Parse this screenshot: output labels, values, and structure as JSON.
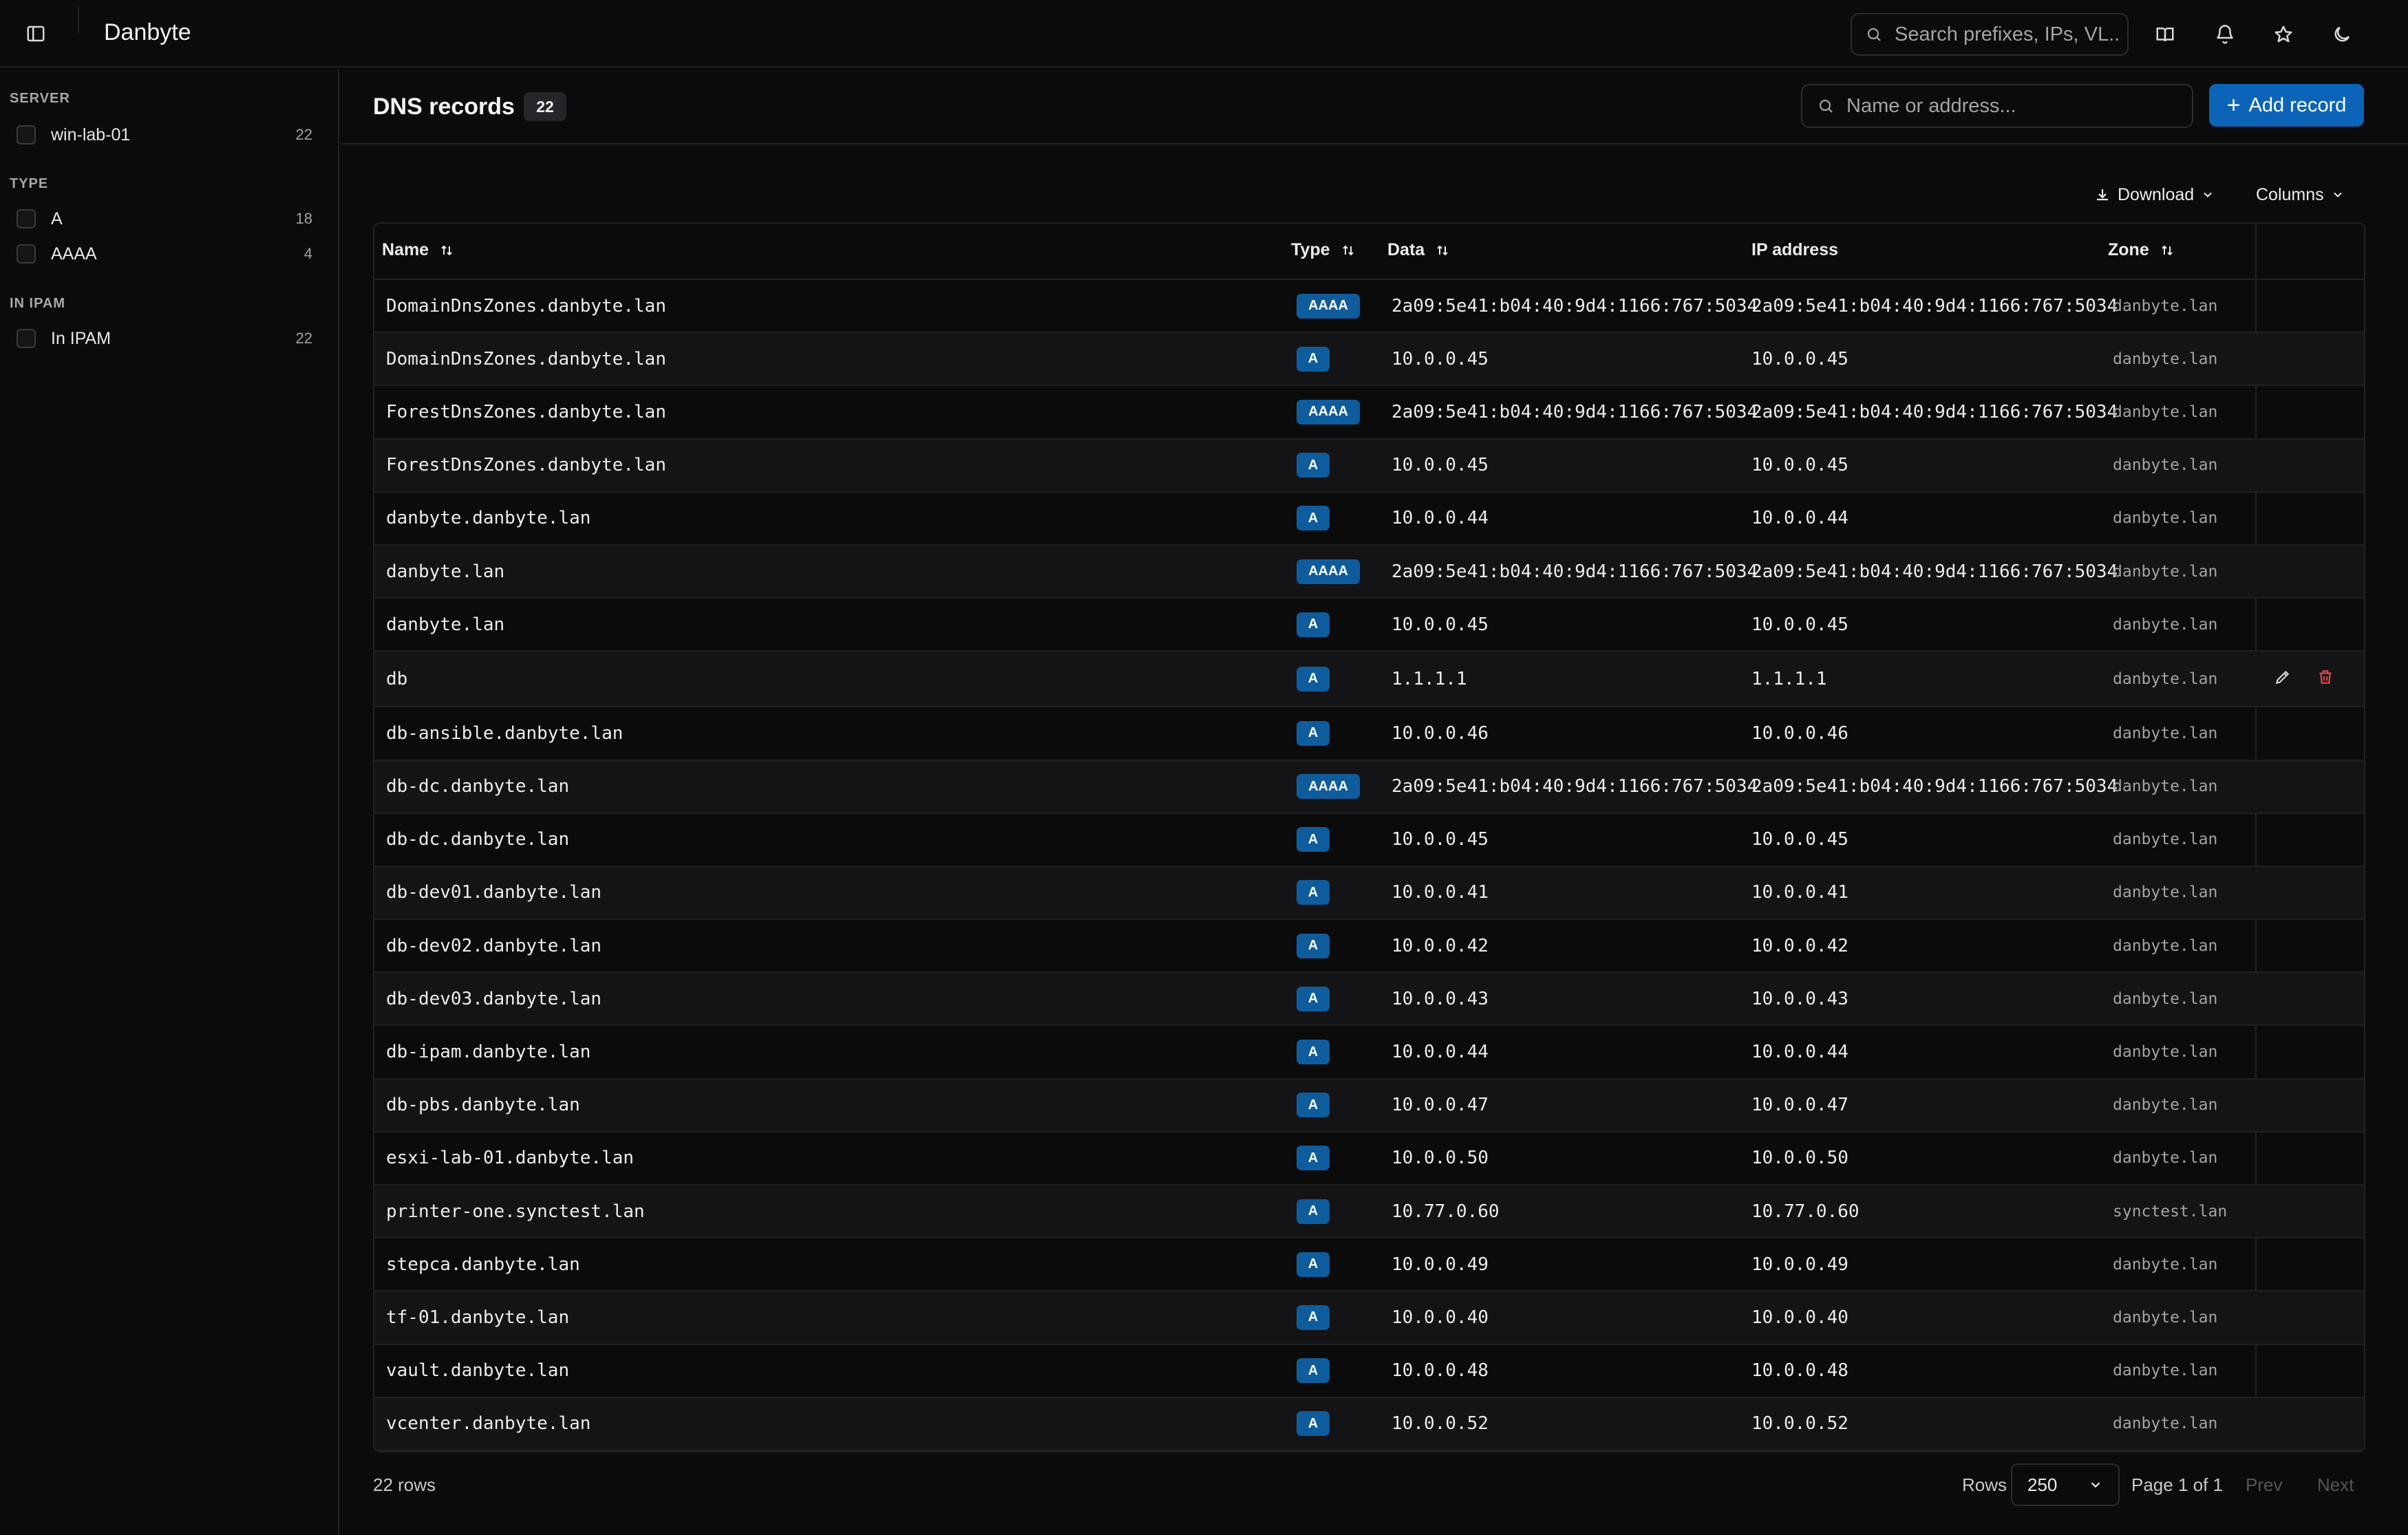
{
  "app": {
    "title": "Danbyte"
  },
  "topbar": {
    "search_placeholder": "Search prefixes, IPs, VL...",
    "icons": [
      "sidebar-toggle-icon",
      "book-icon",
      "bell-icon",
      "star-icon",
      "moon-icon"
    ]
  },
  "sidebar": {
    "facets": [
      {
        "title": "SERVER",
        "items": [
          {
            "label": "win-lab-01",
            "count": "22"
          }
        ]
      },
      {
        "title": "TYPE",
        "items": [
          {
            "label": "A",
            "count": "18"
          },
          {
            "label": "AAAA",
            "count": "4"
          }
        ]
      },
      {
        "title": "IN IPAM",
        "items": [
          {
            "label": "In IPAM",
            "count": "22"
          }
        ]
      }
    ]
  },
  "header": {
    "title": "DNS records",
    "count": "22",
    "search_placeholder": "Name or address...",
    "add_label": "Add record"
  },
  "toolbar": {
    "download_label": "Download",
    "columns_label": "Columns"
  },
  "table": {
    "columns": [
      "Name",
      "Type",
      "Data",
      "IP address",
      "Zone"
    ],
    "rows": [
      {
        "name": "DomainDnsZones.danbyte.lan",
        "type": "AAAA",
        "data": "2a09:5e41:b04:40:9d4:1166:767:5034",
        "ip": "2a09:5e41:b04:40:9d4:1166:767:5034",
        "zone": "danbyte.lan"
      },
      {
        "name": "DomainDnsZones.danbyte.lan",
        "type": "A",
        "data": "10.0.0.45",
        "ip": "10.0.0.45",
        "zone": "danbyte.lan"
      },
      {
        "name": "ForestDnsZones.danbyte.lan",
        "type": "AAAA",
        "data": "2a09:5e41:b04:40:9d4:1166:767:5034",
        "ip": "2a09:5e41:b04:40:9d4:1166:767:5034",
        "zone": "danbyte.lan"
      },
      {
        "name": "ForestDnsZones.danbyte.lan",
        "type": "A",
        "data": "10.0.0.45",
        "ip": "10.0.0.45",
        "zone": "danbyte.lan"
      },
      {
        "name": "danbyte.danbyte.lan",
        "type": "A",
        "data": "10.0.0.44",
        "ip": "10.0.0.44",
        "zone": "danbyte.lan"
      },
      {
        "name": "danbyte.lan",
        "type": "AAAA",
        "data": "2a09:5e41:b04:40:9d4:1166:767:5034",
        "ip": "2a09:5e41:b04:40:9d4:1166:767:5034",
        "zone": "danbyte.lan"
      },
      {
        "name": "danbyte.lan",
        "type": "A",
        "data": "10.0.0.45",
        "ip": "10.0.0.45",
        "zone": "danbyte.lan"
      },
      {
        "name": "db",
        "type": "A",
        "data": "1.1.1.1",
        "ip": "1.1.1.1",
        "zone": "danbyte.lan",
        "hovered": true
      },
      {
        "name": "db-ansible.danbyte.lan",
        "type": "A",
        "data": "10.0.0.46",
        "ip": "10.0.0.46",
        "zone": "danbyte.lan"
      },
      {
        "name": "db-dc.danbyte.lan",
        "type": "AAAA",
        "data": "2a09:5e41:b04:40:9d4:1166:767:5034",
        "ip": "2a09:5e41:b04:40:9d4:1166:767:5034",
        "zone": "danbyte.lan"
      },
      {
        "name": "db-dc.danbyte.lan",
        "type": "A",
        "data": "10.0.0.45",
        "ip": "10.0.0.45",
        "zone": "danbyte.lan"
      },
      {
        "name": "db-dev01.danbyte.lan",
        "type": "A",
        "data": "10.0.0.41",
        "ip": "10.0.0.41",
        "zone": "danbyte.lan"
      },
      {
        "name": "db-dev02.danbyte.lan",
        "type": "A",
        "data": "10.0.0.42",
        "ip": "10.0.0.42",
        "zone": "danbyte.lan"
      },
      {
        "name": "db-dev03.danbyte.lan",
        "type": "A",
        "data": "10.0.0.43",
        "ip": "10.0.0.43",
        "zone": "danbyte.lan"
      },
      {
        "name": "db-ipam.danbyte.lan",
        "type": "A",
        "data": "10.0.0.44",
        "ip": "10.0.0.44",
        "zone": "danbyte.lan"
      },
      {
        "name": "db-pbs.danbyte.lan",
        "type": "A",
        "data": "10.0.0.47",
        "ip": "10.0.0.47",
        "zone": "danbyte.lan"
      },
      {
        "name": "esxi-lab-01.danbyte.lan",
        "type": "A",
        "data": "10.0.0.50",
        "ip": "10.0.0.50",
        "zone": "danbyte.lan"
      },
      {
        "name": "printer-one.synctest.lan",
        "type": "A",
        "data": "10.77.0.60",
        "ip": "10.77.0.60",
        "zone": "synctest.lan"
      },
      {
        "name": "stepca.danbyte.lan",
        "type": "A",
        "data": "10.0.0.49",
        "ip": "10.0.0.49",
        "zone": "danbyte.lan"
      },
      {
        "name": "tf-01.danbyte.lan",
        "type": "A",
        "data": "10.0.0.40",
        "ip": "10.0.0.40",
        "zone": "danbyte.lan"
      },
      {
        "name": "vault.danbyte.lan",
        "type": "A",
        "data": "10.0.0.48",
        "ip": "10.0.0.48",
        "zone": "danbyte.lan"
      },
      {
        "name": "vcenter.danbyte.lan",
        "type": "A",
        "data": "10.0.0.52",
        "ip": "10.0.0.52",
        "zone": "danbyte.lan"
      }
    ]
  },
  "footer": {
    "row_count": "22 rows",
    "rows_label": "Rows",
    "rows_value": "250",
    "page_text": "Page 1 of 1",
    "prev_label": "Prev",
    "next_label": "Next"
  },
  "colors": {
    "accent": "#0c64b8",
    "type_pill": "#0f5c9d",
    "delete": "#e5484d",
    "background": "#0b0b0c"
  }
}
